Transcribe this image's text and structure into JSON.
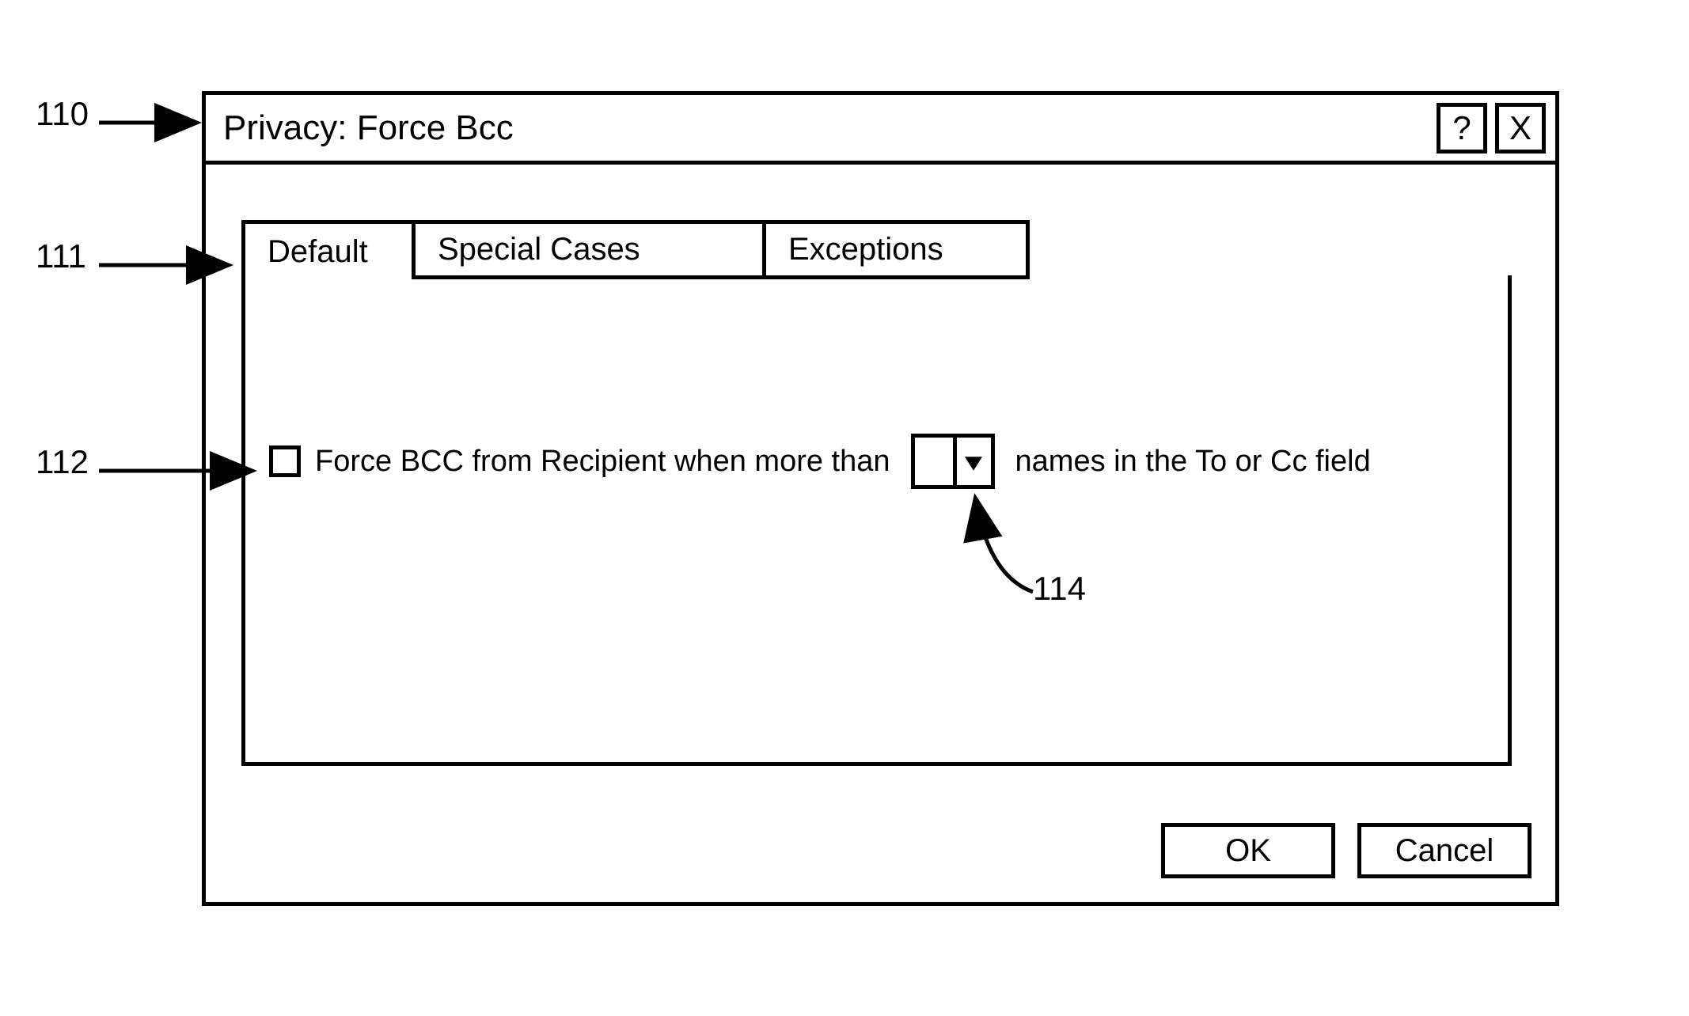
{
  "dialog": {
    "title": "Privacy: Force Bcc",
    "help_label": "?",
    "close_label": "X"
  },
  "tabs": {
    "default": "Default",
    "special": "Special Cases",
    "exceptions": "Exceptions"
  },
  "option": {
    "checkbox_checked": false,
    "text_before": "Force BCC from Recipient when more than",
    "combo_value": "",
    "text_after": "names in the To or Cc field"
  },
  "buttons": {
    "ok": "OK",
    "cancel": "Cancel"
  },
  "callouts": {
    "c110": "110",
    "c111": "111",
    "c112": "112",
    "c114": "114"
  }
}
